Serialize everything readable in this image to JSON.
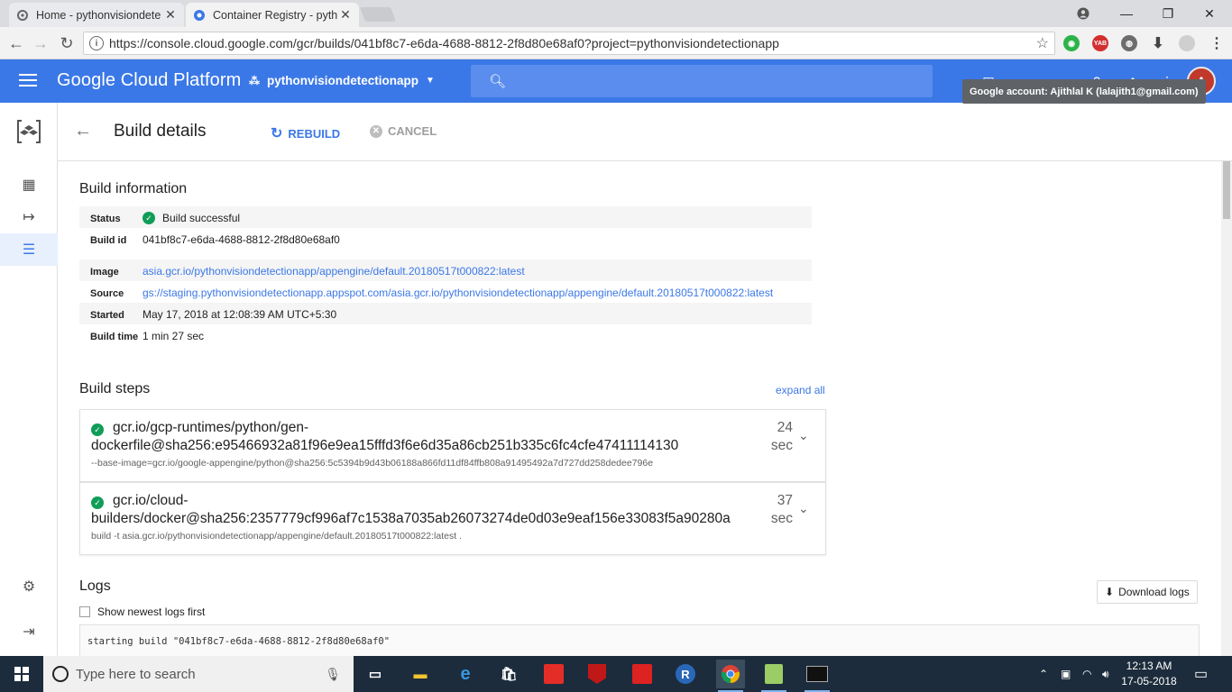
{
  "browser": {
    "tabs": [
      {
        "title": "Home - pythonvisiondete",
        "active": false
      },
      {
        "title": "Container Registry - pyth",
        "active": true
      }
    ],
    "url": "https://console.cloud.google.com/gcr/builds/041bf8c7-e6da-4688-8812-2f8d80e68af0?project=pythonvisiondetectionapp",
    "extensions": [
      "ext-green-icon",
      "ext-yab-icon",
      "ext-globe-icon",
      "download-icon",
      "ext-circle-icon"
    ],
    "ext_yab_label": "YAB"
  },
  "gcp": {
    "brand": "Google Cloud Platform",
    "project": "pythonvisiondetectionapp",
    "account_tooltip": "Google account: Ajithlal K (lalajith1@gmail.com)"
  },
  "page": {
    "title": "Build details",
    "rebuild_label": "REBUILD",
    "cancel_label": "CANCEL"
  },
  "build_info": {
    "section_title": "Build information",
    "rows": [
      {
        "key": "Status",
        "value": "Build successful"
      },
      {
        "key": "Build id",
        "value": "041bf8c7-e6da-4688-8812-2f8d80e68af0"
      },
      {
        "key": "Image",
        "value": "asia.gcr.io/pythonvisiondetectionapp/appengine/default.20180517t000822:latest"
      },
      {
        "key": "Source",
        "value": "gs://staging.pythonvisiondetectionapp.appspot.com/asia.gcr.io/pythonvisiondetectionapp/appengine/default.20180517t000822:latest"
      },
      {
        "key": "Started",
        "value": "May 17, 2018 at 12:08:39 AM UTC+5:30"
      },
      {
        "key": "Build time",
        "value": "1 min 27 sec"
      }
    ]
  },
  "build_steps": {
    "section_title": "Build steps",
    "expand_all": "expand all",
    "steps": [
      {
        "name": "gcr.io/gcp-runtimes/python/gen-dockerfile@sha256:e95466932a81f96e9ea15fffd3f6e6d35a86cb251b335c6fc4cfe47411114130",
        "args": "--base-image=gcr.io/google-appengine/python@sha256:5c5394b9d43b06188a866fd11df84ffb808a91495492a7d727dd258dedee796e",
        "duration": "24 sec"
      },
      {
        "name": "gcr.io/cloud-builders/docker@sha256:2357779cf996af7c1538a7035ab26073274de0d03e9eaf156e33083f5a90280a",
        "args": "build -t asia.gcr.io/pythonvisiondetectionapp/appengine/default.20180517t000822:latest .",
        "duration": "37 sec"
      }
    ]
  },
  "logs": {
    "section_title": "Logs",
    "download_label": "Download logs",
    "newest_first_label": "Show newest logs first",
    "first_line": "starting build \"041bf8c7-e6da-4688-8812-2f8d80e68af0\""
  },
  "taskbar": {
    "search_placeholder": "Type here to search",
    "time": "12:13 AM",
    "date": "17-05-2018"
  },
  "colors": {
    "gcp_blue": "#3b78e7",
    "success_green": "#0f9d58",
    "taskbar": "#1c2c3c"
  }
}
